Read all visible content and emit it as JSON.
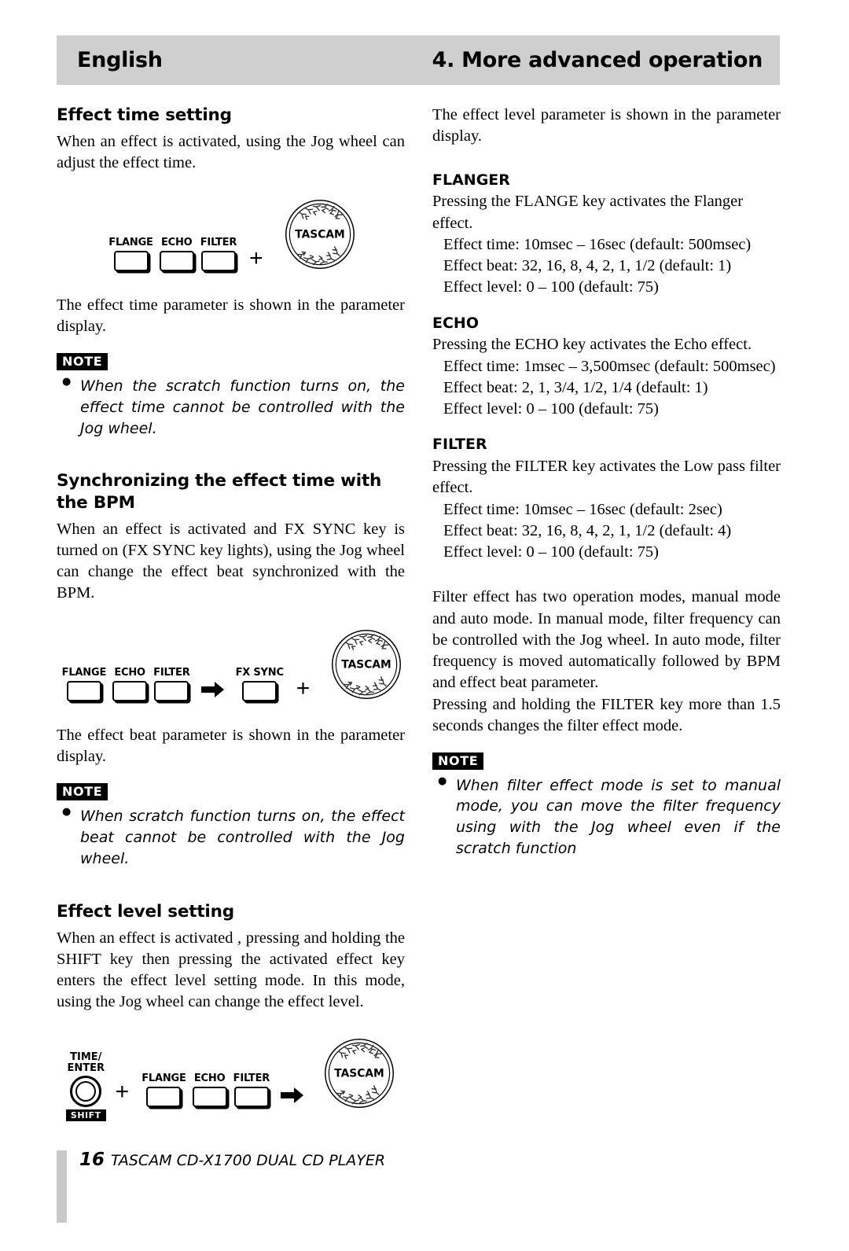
{
  "header": {
    "left": "English",
    "right": "4. More advanced operation"
  },
  "left_column": {
    "section1": {
      "heading": "Effect time setting",
      "intro": "When an effect is activated, using the Jog wheel can adjust the effect time.",
      "diagram": {
        "keys": [
          "FLANGE",
          "ECHO",
          "FILTER"
        ],
        "operator": "+",
        "wheel_label": "TASCAM"
      },
      "after": "The effect time parameter is shown in the parameter display.",
      "note": {
        "badge": "NOTE",
        "items": [
          "When the scratch function  turns on, the effect time cannot be controlled with the Jog wheel."
        ]
      }
    },
    "section2": {
      "heading": "Synchronizing the effect time with the BPM",
      "intro": "When an effect is activated and FX SYNC key is turned on (FX SYNC key lights), using the Jog wheel can change the effect beat synchronized with the BPM.",
      "diagram": {
        "keys": [
          "FLANGE",
          "ECHO",
          "FILTER"
        ],
        "arrow": "➡",
        "sync_key": "FX SYNC",
        "operator": "+",
        "wheel_label": "TASCAM"
      },
      "after": "The effect beat parameter is shown in the parameter display.",
      "note": {
        "badge": "NOTE",
        "items": [
          "When scratch function  turns on, the effect beat cannot be controlled with the Jog wheel."
        ]
      }
    },
    "section3": {
      "heading": "Effect level setting",
      "intro": "When an effect is activated ,  pressing and holding the SHIFT key then pressing the activated effect key enters the effect level setting mode.  In this mode, using the Jog wheel can change the effect level.",
      "diagram": {
        "knob_label_line1": "TIME/",
        "knob_label_line2": "ENTER",
        "shift_badge": "SHIFT",
        "operator": "+",
        "keys": [
          "FLANGE",
          "ECHO",
          "FILTER"
        ],
        "arrow": "➡",
        "wheel_label": "TASCAM"
      }
    }
  },
  "right_column": {
    "intro": "The effect level parameter is shown in the parameter display.",
    "effects": [
      {
        "name": "FLANGER",
        "desc": "Pressing the FLANGE key activates the Flanger effect.",
        "specs": [
          "Effect time:   10msec – 16sec (default: 500msec)",
          "Effect beat:   32, 16, 8, 4, 2, 1, 1/2 (default: 1)",
          "Effect level:  0 – 100 (default: 75)"
        ]
      },
      {
        "name": "ECHO",
        "desc": "Pressing the ECHO key activates the Echo effect.",
        "specs": [
          "Effect time:  1msec   –   3,500msec   (default: 500msec)",
          "Effect beat:   2, 1, 3/4, 1/2, 1/4 (default: 1)",
          "Effect level:  0 – 100 (default: 75)"
        ]
      },
      {
        "name": "FILTER",
        "desc": "Pressing the FILTER key activates the Low pass filter effect.",
        "specs": [
          "Effect time:   10msec – 16sec (default: 2sec)",
          "Effect beat:   32, 16, 8, 4, 2, 1, 1/2 (default: 4)",
          "Effect level:  0 – 100 (default: 75)"
        ]
      }
    ],
    "filter_modes": "Filter effect has two operation modes, manual mode and auto mode.  In manual mode, filter frequency can be  controlled with the Jog wheel.  In auto mode, filter frequency is moved automatically followed by BPM and effect beat parameter.",
    "filter_hold": "Pressing and holding the FILTER key more than 1.5 seconds changes the filter effect mode.",
    "note": {
      "badge": "NOTE",
      "items": [
        "When filter effect mode is set to manual mode, you can move the filter frequency using with the Jog wheel even if the scratch function"
      ]
    }
  },
  "footer": {
    "page": "16",
    "text": "TASCAM  CD-X1700  DUAL CD PLAYER"
  }
}
